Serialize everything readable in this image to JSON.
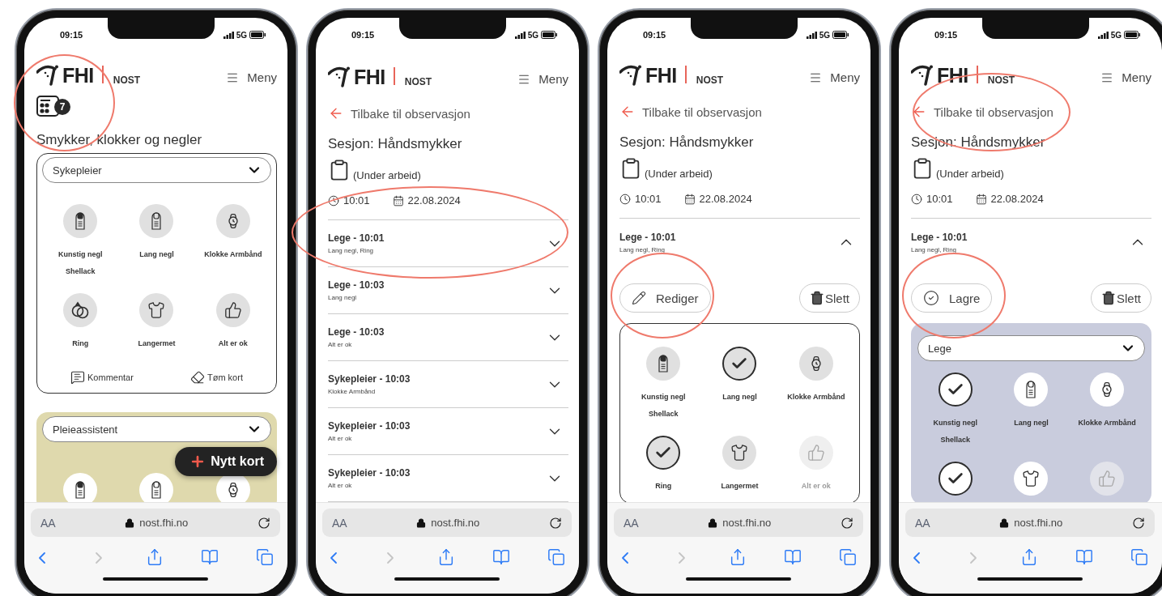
{
  "phones": [
    {
      "status_bar": {
        "time": "09:15",
        "network": "5G"
      },
      "header": {
        "logo": "FHI",
        "product": "NOST",
        "menu": "Meny"
      },
      "screen": {
        "kind": "card_entry",
        "counter": {
          "count": "7",
          "circled": true
        },
        "title": "Smykker, klokker og negler",
        "cards": [
          {
            "role": "Sykepleier",
            "color": "#ffffff",
            "items": [
              {
                "kind": "artificial-nail",
                "label": "Kunstig negl\nShellack",
                "checked": false,
                "disabled": false
              },
              {
                "kind": "long-nail",
                "label": "Lang negl",
                "checked": false,
                "disabled": false
              },
              {
                "kind": "watch",
                "label": "Klokke Armbånd",
                "checked": false,
                "disabled": false
              },
              {
                "kind": "ring",
                "label": "Ring",
                "checked": false,
                "disabled": false
              },
              {
                "kind": "long-sleeve",
                "label": "Langermet",
                "checked": false,
                "disabled": false
              },
              {
                "kind": "thumbs-up",
                "label": "Alt er ok",
                "checked": false,
                "disabled": false
              }
            ],
            "actions": [
              {
                "kind": "comment",
                "label": "Kommentar"
              },
              {
                "kind": "clear",
                "label": "Tøm kort"
              }
            ]
          },
          {
            "role": "Pleieassistent",
            "color": "#dfd9ad",
            "items": [
              {
                "kind": "artificial-nail",
                "checked": false,
                "disabled": false
              },
              {
                "kind": "long-nail",
                "checked": false,
                "disabled": false
              },
              {
                "kind": "watch",
                "checked": false,
                "disabled": false
              }
            ]
          }
        ],
        "fab": {
          "label": "Nytt kort"
        }
      },
      "browser": {
        "text_size": "AA",
        "url": "nost.fhi.no"
      }
    },
    {
      "status_bar": {
        "time": "09:15",
        "network": "5G"
      },
      "header": {
        "logo": "FHI",
        "product": "NOST",
        "menu": "Meny"
      },
      "screen": {
        "kind": "session",
        "back": {
          "label": "Tilbake til observasjon",
          "circled": false
        },
        "title": "Sesjon: Håndsmykker",
        "status": "(Under arbeid)",
        "time": "10:01",
        "date": "22.08.2024",
        "entries": [
          {
            "title": "Lege - 10:01",
            "detail": "Lang negl, Ring",
            "expanded": false,
            "circled": true
          },
          {
            "title": "Lege - 10:03",
            "detail": "Lang negl",
            "expanded": false,
            "circled": false
          },
          {
            "title": "Lege - 10:03",
            "detail": "Alt er ok",
            "expanded": false,
            "circled": false
          },
          {
            "title": "Sykepleier - 10:03",
            "detail": "Klokke Armbånd",
            "expanded": false,
            "circled": false
          },
          {
            "title": "Sykepleier - 10:03",
            "detail": "Alt er ok",
            "expanded": false,
            "circled": false
          },
          {
            "title": "Sykepleier - 10:03",
            "detail": "Alt er ok",
            "expanded": false,
            "circled": false
          }
        ]
      },
      "browser": {
        "text_size": "AA",
        "url": "nost.fhi.no"
      }
    },
    {
      "status_bar": {
        "time": "09:15",
        "network": "5G"
      },
      "header": {
        "logo": "FHI",
        "product": "NOST",
        "menu": "Meny"
      },
      "screen": {
        "kind": "session",
        "back": {
          "label": "Tilbake til observasjon",
          "circled": false
        },
        "title": "Sesjon: Håndsmykker",
        "status": "(Under arbeid)",
        "time": "10:01",
        "date": "22.08.2024",
        "entries": [
          {
            "title": "Lege - 10:01",
            "detail": "Lang negl, Ring",
            "expanded": true,
            "circled": false,
            "primary": {
              "kind": "edit",
              "label": "Rediger",
              "circled": true
            },
            "delete": {
              "label": "Slett"
            },
            "card": {
              "color": "#ffffff",
              "items": [
                {
                  "kind": "artificial-nail",
                  "label": "Kunstig negl\nShellack",
                  "checked": false,
                  "disabled": false
                },
                {
                  "kind": "long-nail",
                  "label": "Lang negl",
                  "checked": true,
                  "disabled": false
                },
                {
                  "kind": "watch",
                  "label": "Klokke Armbånd",
                  "checked": false,
                  "disabled": false
                },
                {
                  "kind": "ring",
                  "label": "Ring",
                  "checked": true,
                  "disabled": false
                },
                {
                  "kind": "long-sleeve",
                  "label": "Langermet",
                  "checked": false,
                  "disabled": false
                },
                {
                  "kind": "thumbs-up",
                  "label": "Alt er ok",
                  "checked": false,
                  "disabled": true
                }
              ]
            }
          }
        ]
      },
      "browser": {
        "text_size": "AA",
        "url": "nost.fhi.no"
      }
    },
    {
      "status_bar": {
        "time": "09:15",
        "network": "5G"
      },
      "header": {
        "logo": "FHI",
        "product": "NOST",
        "menu": "Meny"
      },
      "screen": {
        "kind": "session",
        "back": {
          "label": "Tilbake til observasjon",
          "circled": true
        },
        "title": "Sesjon: Håndsmykker",
        "status": "(Under arbeid)",
        "time": "10:01",
        "date": "22.08.2024",
        "entries": [
          {
            "title": "Lege - 10:01",
            "detail": "Lang negl, Ring",
            "expanded": true,
            "circled": false,
            "primary": {
              "kind": "save",
              "label": "Lagre",
              "circled": true
            },
            "delete": {
              "label": "Slett"
            },
            "card": {
              "role": "Lege",
              "color": "#c9ccdd",
              "items": [
                {
                  "kind": "artificial-nail",
                  "label": "Kunstig negl\nShellack",
                  "checked": true,
                  "disabled": false
                },
                {
                  "kind": "long-nail",
                  "label": "Lang negl",
                  "checked": false,
                  "disabled": false
                },
                {
                  "kind": "watch",
                  "label": "Klokke Armbånd",
                  "checked": false,
                  "disabled": false
                },
                {
                  "kind": "ring",
                  "checked": true,
                  "disabled": false
                },
                {
                  "kind": "long-sleeve",
                  "checked": false,
                  "disabled": false
                },
                {
                  "kind": "thumbs-up",
                  "checked": false,
                  "disabled": true
                }
              ]
            }
          }
        ]
      },
      "browser": {
        "text_size": "AA",
        "url": "nost.fhi.no"
      }
    }
  ]
}
